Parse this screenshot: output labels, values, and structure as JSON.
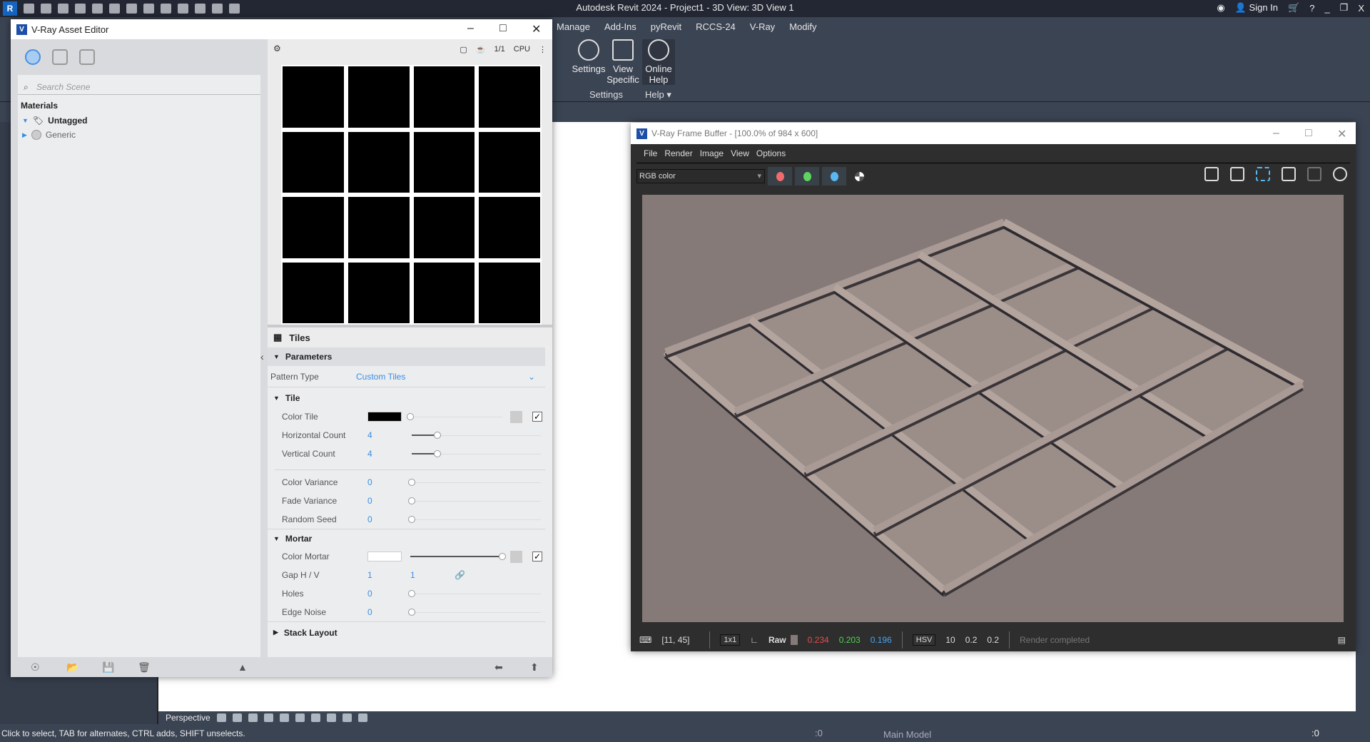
{
  "app": {
    "title": "Autodesk Revit 2024 - Project1 - 3D View: 3D View 1",
    "logo": "R",
    "sign_in": "Sign In",
    "help_icon": "?"
  },
  "ribbon": {
    "tabs": [
      "Manage",
      "Add-Ins",
      "pyRevit",
      "RCCS-24",
      "V-Ray",
      "Modify"
    ],
    "active_tab": "V-Ray",
    "buttons": [
      {
        "label": "Settings",
        "icon": "gear-icon"
      },
      {
        "label": "View Specific",
        "icon": "view-specific-icon"
      },
      {
        "label": "Online Help",
        "icon": "help-icon"
      }
    ],
    "groups": [
      "Settings",
      "Help ▾"
    ]
  },
  "asset_editor": {
    "title": "V-Ray Asset Editor",
    "search_placeholder": "Search Scene",
    "section": "Materials",
    "tree": [
      {
        "label": "Untagged",
        "expanded": true
      },
      {
        "label": "Generic",
        "expanded": false
      }
    ],
    "preview_toolbar": {
      "ratio": "1/1",
      "engine": "CPU"
    },
    "texture_name": "Tiles",
    "parameters": {
      "label": "Parameters",
      "pattern_type_label": "Pattern Type",
      "pattern_type": "Custom Tiles",
      "tile": {
        "label": "Tile",
        "rows": [
          {
            "label": "Color Tile",
            "color": "#000000",
            "slider": 0,
            "checked": true
          },
          {
            "label": "Horizontal Count",
            "value": "4",
            "slider": 0.2
          },
          {
            "label": "Vertical Count",
            "value": "4",
            "slider": 0.2
          },
          {
            "label": "Color Variance",
            "value": "0",
            "slider": 0
          },
          {
            "label": "Fade Variance",
            "value": "0",
            "slider": 0
          },
          {
            "label": "Random Seed",
            "value": "0",
            "slider": 0
          }
        ]
      },
      "mortar": {
        "label": "Mortar",
        "rows": [
          {
            "label": "Color Mortar",
            "color": "#ffffff",
            "slider": 1,
            "checked": true
          },
          {
            "label": "Gap H / V",
            "value": "1",
            "value2": "1"
          },
          {
            "label": "Holes",
            "value": "0",
            "slider": 0
          },
          {
            "label": "Edge Noise",
            "value": "0",
            "slider": 0
          }
        ]
      },
      "stack_layout": "Stack Layout"
    }
  },
  "frame_buffer": {
    "title": "V-Ray Frame Buffer - [100.0% of 984 x 600]",
    "menu": [
      "File",
      "Render",
      "Image",
      "View",
      "Options"
    ],
    "channel": "RGB color",
    "channel_colors": [
      "#f06b6b",
      "#5fd35f",
      "#5ab8f0"
    ],
    "status": {
      "coords": "[11, 45]",
      "zoom": "1x1",
      "raw": "Raw",
      "r": "0.234",
      "g": "0.203",
      "b": "0.196",
      "mode": "HSV",
      "h": "10",
      "s": "0.2",
      "v": "0.2",
      "message": "Render completed"
    },
    "colors": {
      "r": "#e84b4b",
      "g": "#4fd34f",
      "b": "#4aa3f0"
    }
  },
  "viewport": {
    "view_mode": "Perspective"
  },
  "statusbar": {
    "message": "Click to select, TAB for alternates, CTRL adds, SHIFT unselects.",
    "workset": ":0",
    "model": "Main Model",
    "filter": ":0"
  }
}
